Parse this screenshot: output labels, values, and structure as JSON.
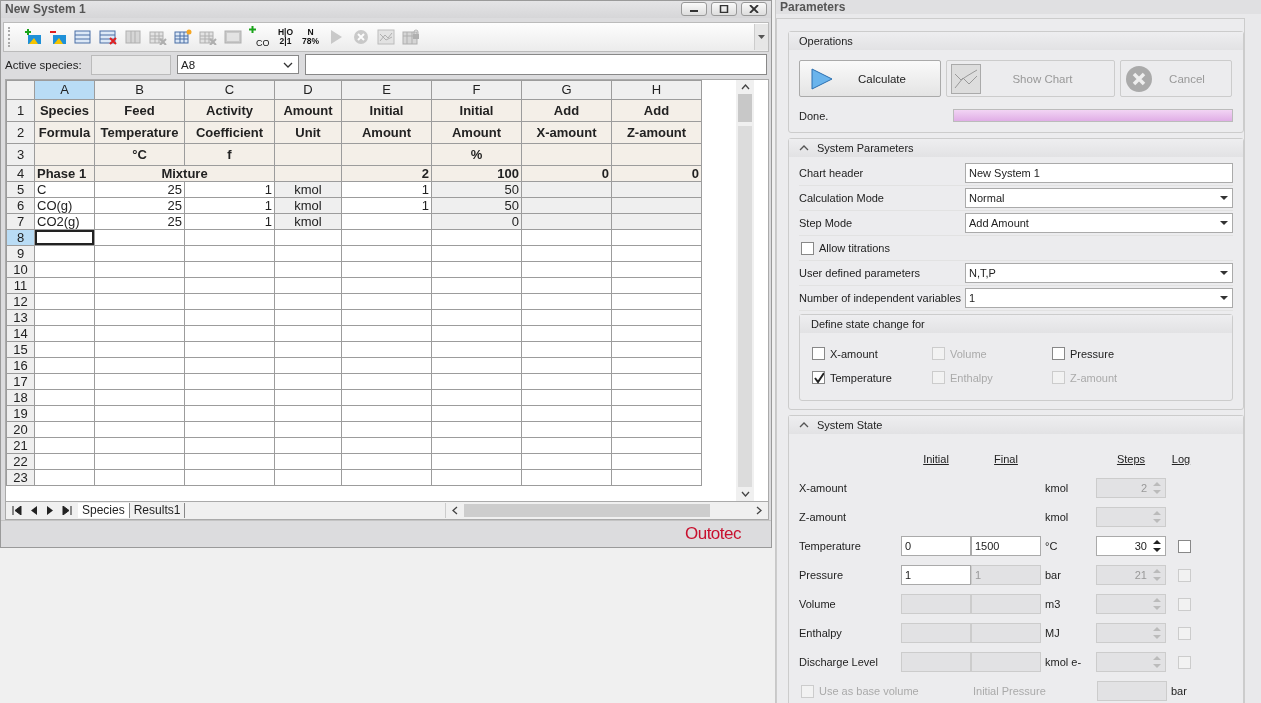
{
  "window": {
    "title": "New System 1"
  },
  "toolbar": [
    {
      "kind": "add-image",
      "disabled": false
    },
    {
      "kind": "remove-image",
      "disabled": false
    },
    {
      "kind": "rows",
      "disabled": false
    },
    {
      "kind": "delete-rows",
      "disabled": false
    },
    {
      "kind": "columns",
      "disabled": true
    },
    {
      "kind": "delete-grid",
      "disabled": true
    },
    {
      "kind": "new-grid",
      "disabled": false
    },
    {
      "kind": "delete-grid",
      "disabled": true
    },
    {
      "kind": "window",
      "disabled": true
    },
    {
      "kind": "add-species",
      "label": "CO",
      "disabled": false
    },
    {
      "kind": "stacked",
      "lines": [
        "H|O",
        "2|1"
      ],
      "disabled": false
    },
    {
      "kind": "stacked",
      "lines": [
        "N",
        "78%"
      ],
      "disabled": false
    },
    {
      "kind": "play",
      "disabled": true
    },
    {
      "kind": "stop",
      "disabled": true
    },
    {
      "kind": "chart",
      "disabled": true
    },
    {
      "kind": "lock",
      "disabled": true
    }
  ],
  "active_species": {
    "label": "Active species:",
    "cell": "A8"
  },
  "sheet": {
    "columns": [
      {
        "label": "A",
        "selected": true,
        "shaded": false
      },
      {
        "label": "B",
        "selected": false,
        "shaded": false
      },
      {
        "label": "C",
        "selected": false,
        "shaded": false
      },
      {
        "label": "D",
        "selected": false,
        "shaded": true
      },
      {
        "label": "E",
        "selected": false,
        "shaded": false
      },
      {
        "label": "F",
        "selected": false,
        "shaded": true
      },
      {
        "label": "G",
        "selected": false,
        "shaded": true
      },
      {
        "label": "H",
        "selected": false,
        "shaded": true
      }
    ],
    "rows": [
      {
        "number": "1",
        "kind": "header",
        "selected": false,
        "cells": [
          "Species",
          "Feed",
          "Activity",
          "Amount",
          "Initial",
          "Initial",
          "Add",
          "Add"
        ]
      },
      {
        "number": "2",
        "kind": "header",
        "selected": false,
        "cells": [
          "Formula",
          "Temperature",
          "Coefficient",
          "Unit",
          "Amount",
          "Amount",
          "X-amount",
          "Z-amount"
        ]
      },
      {
        "number": "3",
        "kind": "header",
        "selected": false,
        "cells": [
          null,
          "°C",
          "f",
          null,
          null,
          "%",
          null,
          null
        ]
      },
      {
        "number": "4",
        "kind": "phase",
        "selected": false,
        "cells": [
          "Phase 1",
          "Mixture",
          null,
          null,
          "2",
          "100",
          "0",
          "0"
        ]
      },
      {
        "number": "5",
        "kind": "data",
        "selected": false,
        "cells": [
          "C",
          "25",
          "1",
          "kmol",
          "1",
          "50",
          null,
          null
        ]
      },
      {
        "number": "6",
        "kind": "data",
        "selected": false,
        "cells": [
          "CO(g)",
          "25",
          "1",
          "kmol",
          "1",
          "50",
          null,
          null
        ]
      },
      {
        "number": "7",
        "kind": "data",
        "selected": false,
        "cells": [
          "CO2(g)",
          "25",
          "1",
          "kmol",
          null,
          "0",
          null,
          null
        ]
      },
      {
        "number": "8",
        "kind": "data",
        "selected": true
      },
      {
        "number": "9",
        "kind": "data",
        "selected": false
      },
      {
        "number": "10",
        "kind": "data",
        "selected": false
      },
      {
        "number": "11",
        "kind": "data",
        "selected": false
      },
      {
        "number": "12",
        "kind": "data",
        "selected": false
      },
      {
        "number": "13",
        "kind": "data",
        "selected": false
      },
      {
        "number": "14",
        "kind": "data",
        "selected": false
      },
      {
        "number": "15",
        "kind": "data",
        "selected": false
      },
      {
        "number": "16",
        "kind": "data",
        "selected": false
      },
      {
        "number": "17",
        "kind": "data",
        "selected": false
      },
      {
        "number": "18",
        "kind": "data",
        "selected": false
      },
      {
        "number": "19",
        "kind": "data",
        "selected": false
      },
      {
        "number": "20",
        "kind": "data",
        "selected": false
      },
      {
        "number": "21",
        "kind": "data",
        "selected": false
      },
      {
        "number": "22",
        "kind": "data",
        "selected": false
      },
      {
        "number": "23",
        "kind": "data",
        "selected": false
      }
    ],
    "tabs": [
      {
        "label": "Species",
        "selected": true
      },
      {
        "label": "Results1",
        "selected": false
      }
    ]
  },
  "logo": "Outotec",
  "parameters": {
    "title": "Parameters",
    "operations": {
      "title": "Operations",
      "buttons": [
        {
          "kind": "calculate",
          "label": "Calculate",
          "disabled": false
        },
        {
          "kind": "chart",
          "label": "Show Chart",
          "disabled": true
        },
        {
          "kind": "cancel",
          "label": "Cancel",
          "disabled": true
        }
      ],
      "status": "Done.",
      "progress": {
        "level": 1
      }
    },
    "system_parameters": {
      "title": "System Parameters",
      "expanded": true,
      "fields": [
        {
          "kind": "text",
          "label": "Chart header",
          "value": "New System 1"
        },
        {
          "kind": "select",
          "label": "Calculation Mode",
          "value": "Normal"
        },
        {
          "kind": "select",
          "label": "Step Mode",
          "value": "Add Amount"
        },
        {
          "kind": "checkbox",
          "label": "Allow titrations",
          "checked": false
        },
        {
          "kind": "select",
          "label": "User defined parameters",
          "value": "N,T,P"
        },
        {
          "kind": "select",
          "label": "Number of independent variables",
          "value": "1"
        }
      ],
      "state_change": {
        "title": "Define state change for",
        "options": [
          {
            "label": "X-amount",
            "checked": false,
            "disabled": false
          },
          {
            "label": "Volume",
            "checked": false,
            "disabled": true
          },
          {
            "label": "Pressure",
            "checked": false,
            "disabled": false
          },
          {
            "label": "Temperature",
            "checked": true,
            "disabled": false
          },
          {
            "label": "Enthalpy",
            "checked": false,
            "disabled": true
          },
          {
            "label": "Z-amount",
            "checked": false,
            "disabled": true
          }
        ]
      }
    },
    "system_state": {
      "title": "System State",
      "expanded": true,
      "headers": [
        "Initial",
        "Final",
        "Steps",
        "Log"
      ],
      "rows": [
        {
          "kind": "amount",
          "label": "X-amount",
          "unit": "kmol",
          "steps": {
            "value": "2",
            "disabled": true
          }
        },
        {
          "kind": "amount",
          "label": "Z-amount",
          "unit": "kmol",
          "steps": {
            "disabled": true
          }
        },
        {
          "kind": "range",
          "label": "Temperature",
          "initial": {
            "value": "0",
            "disabled": false
          },
          "final": {
            "value": "1500",
            "disabled": false
          },
          "unit": "°C",
          "steps": {
            "value": "30",
            "disabled": false
          },
          "log": {
            "checked": false,
            "disabled": false
          }
        },
        {
          "kind": "range",
          "label": "Pressure",
          "initial": {
            "value": "1",
            "disabled": false
          },
          "final": {
            "value": "1",
            "disabled": true
          },
          "unit": "bar",
          "steps": {
            "value": "21",
            "disabled": true
          },
          "log": {
            "checked": false,
            "disabled": true
          }
        },
        {
          "kind": "range",
          "label": "Volume",
          "initial": {
            "disabled": true
          },
          "final": {
            "disabled": true
          },
          "unit": "m3",
          "steps": {
            "disabled": true
          },
          "log": {
            "checked": false,
            "disabled": true
          }
        },
        {
          "kind": "range",
          "label": "Enthalpy",
          "initial": {
            "disabled": true
          },
          "final": {
            "disabled": true
          },
          "unit": "MJ",
          "steps": {
            "disabled": true
          },
          "log": {
            "checked": false,
            "disabled": true
          }
        },
        {
          "kind": "range",
          "label": "Discharge Level",
          "initial": {
            "disabled": true
          },
          "final": {
            "disabled": true
          },
          "unit": "kmol e-",
          "steps": {
            "disabled": true
          },
          "log": {
            "checked": false,
            "disabled": true
          }
        }
      ],
      "base_volume": {
        "label": "Use as base volume",
        "checked": false,
        "disabled": true
      },
      "initial_pressure": {
        "label": "Initial Pressure",
        "unit": "bar",
        "disabled": true
      }
    }
  }
}
